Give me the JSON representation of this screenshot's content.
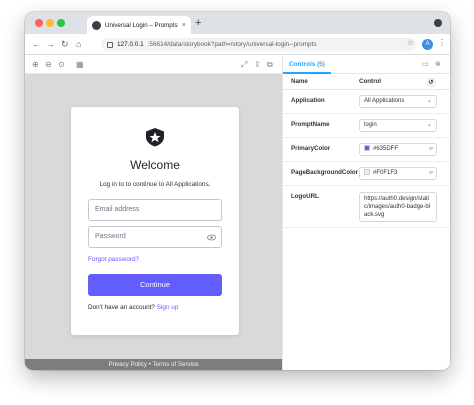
{
  "browser": {
    "tab_title": "Universal Login – Prompts – Sto",
    "tab_close": "×",
    "new_tab": "+",
    "url_host": "127.0.0.1",
    "url_path": ":56614/data/storybook?path=/story/universal-login--prompts",
    "ext_letter": "A"
  },
  "login": {
    "title": "Welcome",
    "subtitle": "Log in to to continue to All Applications.",
    "email_placeholder": "Email address",
    "password_placeholder": "Password",
    "forgot_label": "Forgot password?",
    "continue_label": "Continue",
    "no_account_text": "Don't have an account?",
    "signup_label": "Sign up",
    "footer_privacy": "Privacy Policy",
    "footer_terms": "• Terms of Service",
    "accent_color": "#635DFF",
    "background_color": "#F0F1F3"
  },
  "controls": {
    "tab_label": "Controls (5)",
    "header_name": "Name",
    "header_control": "Control",
    "rows": [
      {
        "name": "Application",
        "value": "All Applications",
        "type": "select"
      },
      {
        "name": "PromptName",
        "value": "login",
        "type": "select"
      },
      {
        "name": "PrimaryColor",
        "value": "#635DFF",
        "type": "color",
        "swatch": "#635DFF"
      },
      {
        "name": "PageBackgroundColor",
        "value": "#F0F1F3",
        "type": "color",
        "swatch": "#F0F1F3"
      },
      {
        "name": "LogoURL",
        "value": "https://auth0.design/static/images/auth0-badge-black.svg",
        "type": "text"
      }
    ]
  }
}
